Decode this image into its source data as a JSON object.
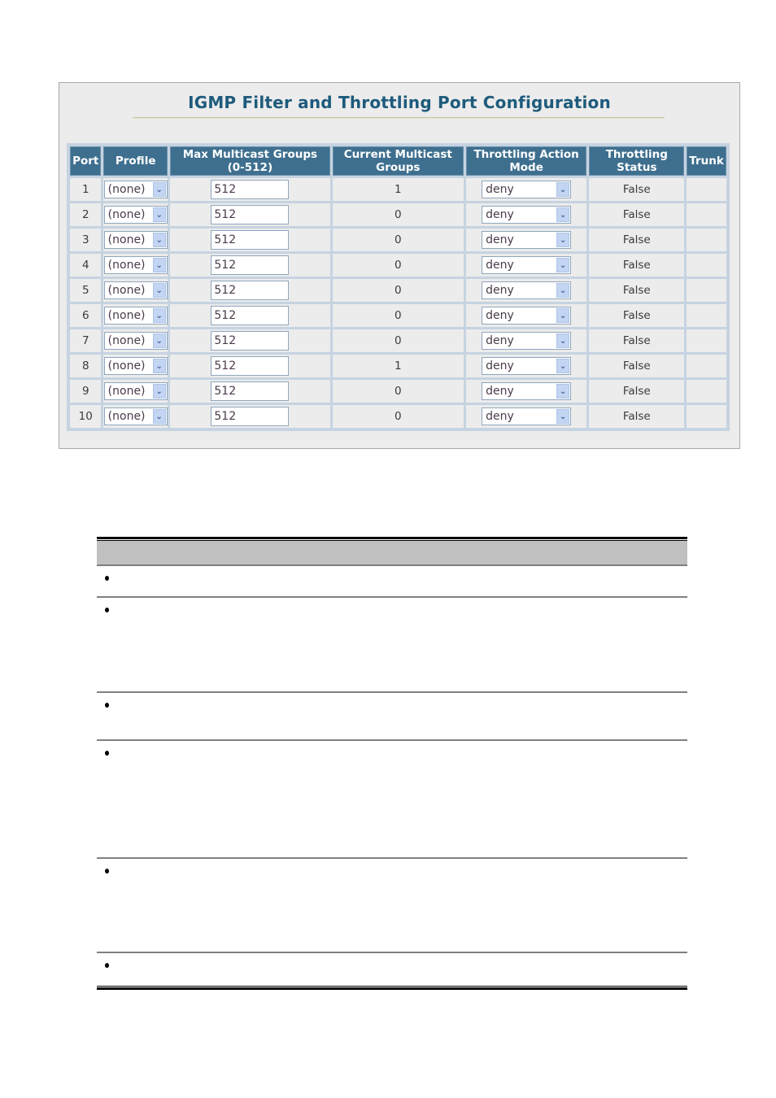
{
  "panel": {
    "title": "IGMP Filter and Throttling Port Configuration"
  },
  "table": {
    "headers": {
      "port": "Port",
      "profile": "Profile",
      "max_groups": "Max Multicast Groups (0-512)",
      "current_groups": "Current Multicast Groups",
      "action_mode": "Throttling Action Mode",
      "status": "Throttling Status",
      "trunk": "Trunk"
    },
    "rows": [
      {
        "port": "1",
        "profile": "(none)",
        "max_groups": "512",
        "current_groups": "1",
        "action_mode": "deny",
        "status": "False",
        "trunk": ""
      },
      {
        "port": "2",
        "profile": "(none)",
        "max_groups": "512",
        "current_groups": "0",
        "action_mode": "deny",
        "status": "False",
        "trunk": ""
      },
      {
        "port": "3",
        "profile": "(none)",
        "max_groups": "512",
        "current_groups": "0",
        "action_mode": "deny",
        "status": "False",
        "trunk": ""
      },
      {
        "port": "4",
        "profile": "(none)",
        "max_groups": "512",
        "current_groups": "0",
        "action_mode": "deny",
        "status": "False",
        "trunk": ""
      },
      {
        "port": "5",
        "profile": "(none)",
        "max_groups": "512",
        "current_groups": "0",
        "action_mode": "deny",
        "status": "False",
        "trunk": ""
      },
      {
        "port": "6",
        "profile": "(none)",
        "max_groups": "512",
        "current_groups": "0",
        "action_mode": "deny",
        "status": "False",
        "trunk": ""
      },
      {
        "port": "7",
        "profile": "(none)",
        "max_groups": "512",
        "current_groups": "0",
        "action_mode": "deny",
        "status": "False",
        "trunk": ""
      },
      {
        "port": "8",
        "profile": "(none)",
        "max_groups": "512",
        "current_groups": "1",
        "action_mode": "deny",
        "status": "False",
        "trunk": ""
      },
      {
        "port": "9",
        "profile": "(none)",
        "max_groups": "512",
        "current_groups": "0",
        "action_mode": "deny",
        "status": "False",
        "trunk": ""
      },
      {
        "port": "10",
        "profile": "(none)",
        "max_groups": "512",
        "current_groups": "0",
        "action_mode": "deny",
        "status": "False",
        "trunk": ""
      }
    ]
  },
  "icons": {
    "dropdown": "chevron-down-icon",
    "bullet": "bullet-dot"
  },
  "colors": {
    "title": "#1e5b7c",
    "header_bg": "#3e6f8f",
    "cell_bg": "#ececec",
    "grid": "#c6d3e1",
    "dropdown_arrow_bg": "#c3d5f3"
  },
  "description_table": {
    "rows": [
      {
        "text": ""
      },
      {
        "text": ""
      },
      {
        "text": ""
      },
      {
        "text": ""
      },
      {
        "text": ""
      },
      {
        "text": ""
      }
    ]
  }
}
